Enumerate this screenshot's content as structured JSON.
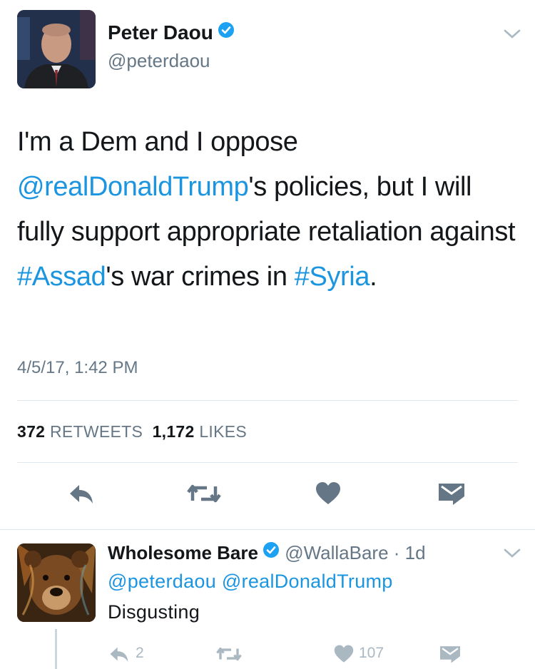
{
  "tweet": {
    "author_name": "Peter Daou",
    "author_handle": "@peterdaou",
    "verified": true,
    "body": {
      "t1": "I'm a Dem and I oppose ",
      "mention": "@realDonaldTrump",
      "t2": "'s policies, but I will fully support appropriate retaliation against ",
      "hashtag1": "#Assad",
      "t3": "'s war crimes in ",
      "hashtag2": "#Syria",
      "t4": "."
    },
    "timestamp": "4/5/17, 1:42 PM",
    "retweets_count": "372",
    "retweets_label": "RETWEETS",
    "likes_count": "1,172",
    "likes_label": "LIKES",
    "actions": [
      "reply-icon",
      "retweet-icon",
      "like-icon",
      "message-icon"
    ]
  },
  "reply": {
    "author_name": "Wholesome Bare",
    "author_handle": "@WallaBare",
    "time": "· 1d",
    "verified": true,
    "mentions": "@peterdaou @realDonaldTrump",
    "text": "Disgusting",
    "reply_count": "2",
    "like_count": "107"
  },
  "colors": {
    "link": "#1b95e0",
    "secondary_text": "#657786",
    "icon": "#657786",
    "icon_light": "#aab8c2",
    "divider": "#e1e8ed",
    "verified": "#1da1f2"
  }
}
